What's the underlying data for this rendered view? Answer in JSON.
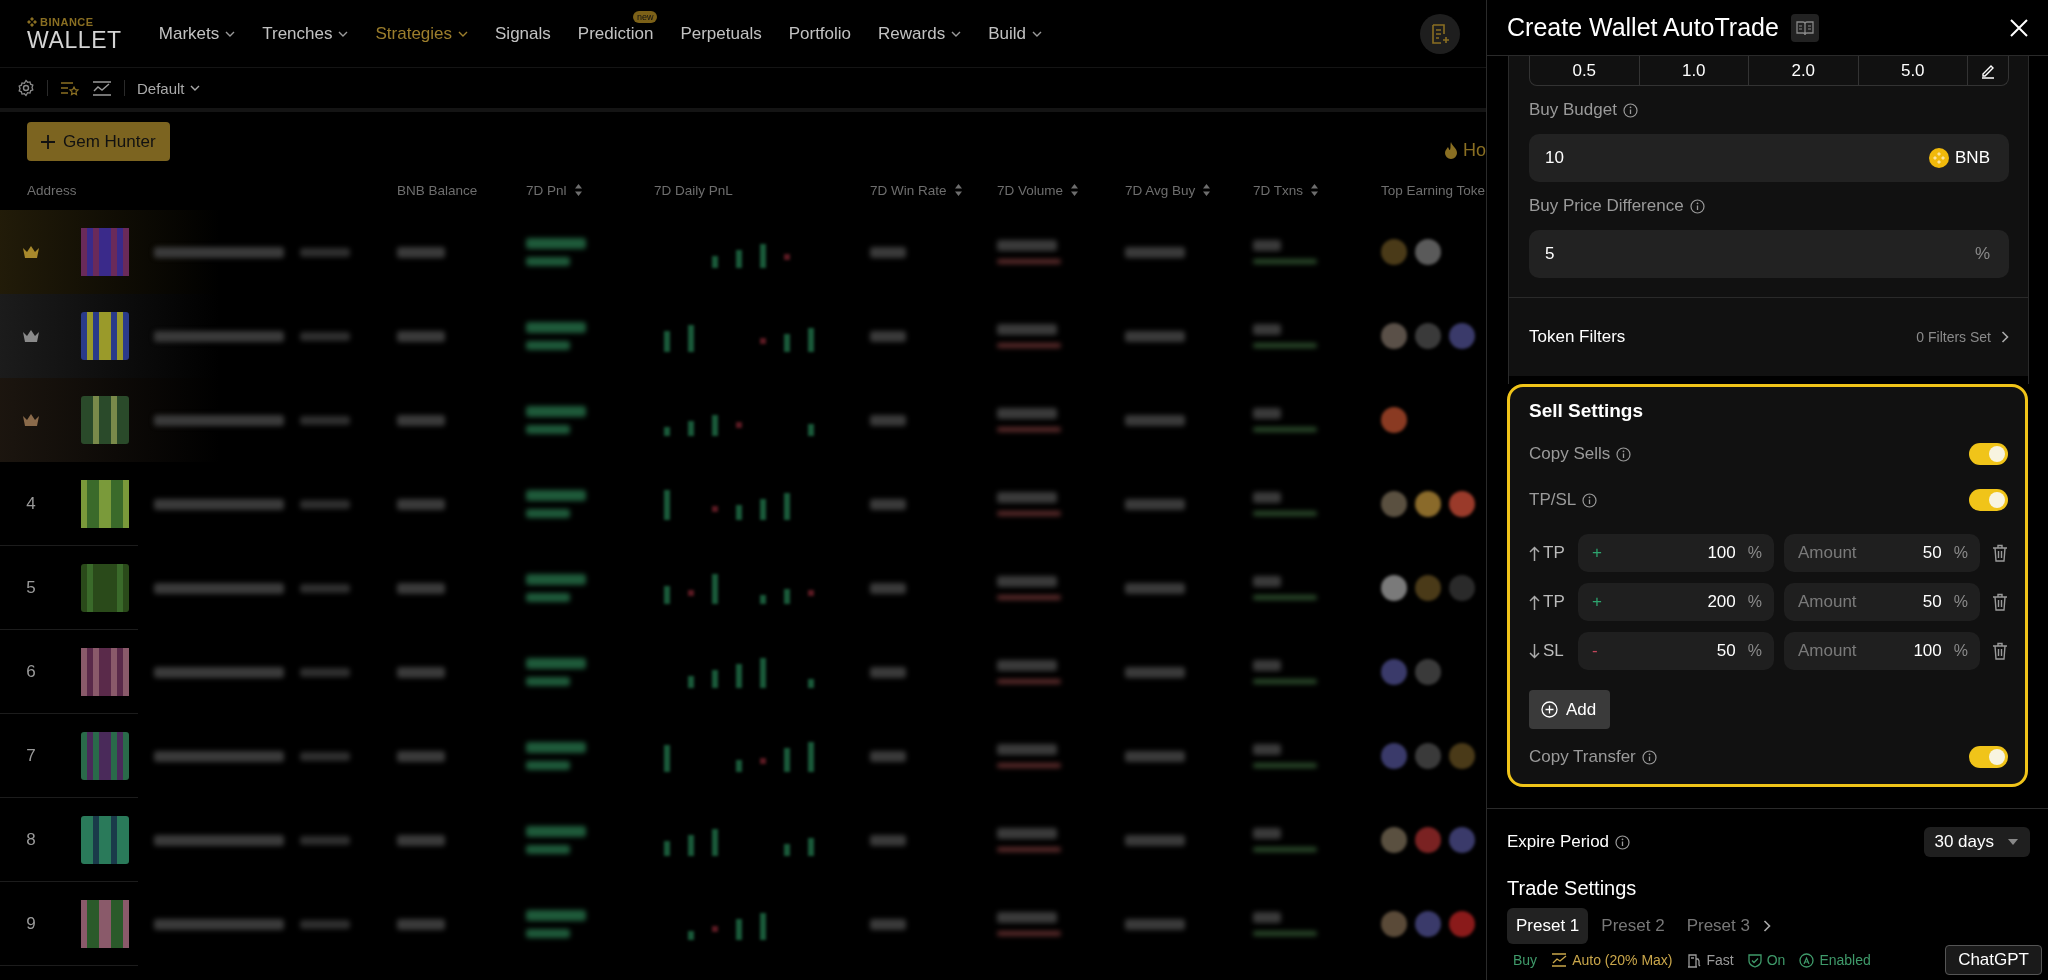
{
  "nav": {
    "logo_top": "BINANCE",
    "logo_bottom": "WALLET",
    "items": [
      {
        "label": "Markets",
        "dropdown": true,
        "selected": false
      },
      {
        "label": "Trenches",
        "dropdown": true,
        "selected": false
      },
      {
        "label": "Strategies",
        "dropdown": true,
        "selected": true
      },
      {
        "label": "Signals",
        "dropdown": false,
        "selected": false
      },
      {
        "label": "Prediction",
        "dropdown": false,
        "selected": false,
        "badge": "new"
      },
      {
        "label": "Perpetuals",
        "dropdown": false,
        "selected": false
      },
      {
        "label": "Portfolio",
        "dropdown": false,
        "selected": false
      },
      {
        "label": "Rewards",
        "dropdown": true,
        "selected": false
      },
      {
        "label": "Build",
        "dropdown": true,
        "selected": false
      }
    ]
  },
  "toolbar": {
    "view": "Default"
  },
  "actions": {
    "gem_hunter": "Gem Hunter",
    "hot_label": "Ho"
  },
  "table": {
    "columns": [
      {
        "label": "Address",
        "sortable": false
      },
      {
        "label": "BNB Balance",
        "sortable": false
      },
      {
        "label": "7D Pnl",
        "sortable": true
      },
      {
        "label": "7D Daily PnL",
        "sortable": false
      },
      {
        "label": "7D Win Rate",
        "sortable": true
      },
      {
        "label": "7D Volume",
        "sortable": true
      },
      {
        "label": "7D Avg Buy",
        "sortable": true
      },
      {
        "label": "7D Txns",
        "sortable": true
      },
      {
        "label": "Top Earning Toke",
        "sortable": false
      }
    ],
    "rows": [
      {
        "kind": "crown",
        "color": "#a8892c"
      },
      {
        "kind": "crown",
        "color": "#8a8a8a"
      },
      {
        "kind": "crown",
        "color": "#8a6a4a"
      },
      {
        "kind": "rank",
        "rank": "4"
      },
      {
        "kind": "rank",
        "rank": "5"
      },
      {
        "kind": "rank",
        "rank": "6"
      },
      {
        "kind": "rank",
        "rank": "7"
      },
      {
        "kind": "rank",
        "rank": "8"
      },
      {
        "kind": "rank",
        "rank": "9"
      }
    ]
  },
  "panel": {
    "title": "Create Wallet AutoTrade",
    "amount_presets": [
      "0.5",
      "1.0",
      "2.0",
      "5.0"
    ],
    "buy_budget": {
      "label": "Buy Budget",
      "value": "10",
      "unit": "BNB"
    },
    "buy_price_difference": {
      "label": "Buy Price Difference",
      "value": "5",
      "unit": "%"
    },
    "token_filters": {
      "label": "Token Filters",
      "value": "0 Filters Set"
    },
    "sell_settings": {
      "title": "Sell Settings",
      "toggles": [
        {
          "label": "Copy Sells",
          "on": true
        },
        {
          "label": "TP/SL",
          "on": true
        }
      ],
      "orders": [
        {
          "kind": "tp",
          "label": "TP",
          "sign": "+",
          "value": "100",
          "unit": "%",
          "amount_label": "Amount",
          "amount": "50",
          "amount_unit": "%"
        },
        {
          "kind": "tp",
          "label": "TP",
          "sign": "+",
          "value": "200",
          "unit": "%",
          "amount_label": "Amount",
          "amount": "50",
          "amount_unit": "%"
        },
        {
          "kind": "sl",
          "label": "SL",
          "sign": "-",
          "value": "50",
          "unit": "%",
          "amount_label": "Amount",
          "amount": "100",
          "amount_unit": "%"
        }
      ],
      "add": "Add",
      "copy_transfer": {
        "label": "Copy Transfer",
        "on": true
      }
    },
    "expire_period": {
      "label": "Expire Period",
      "value": "30 days"
    },
    "trade_settings": {
      "title": "Trade Settings",
      "presets": [
        {
          "label": "Preset 1",
          "selected": true
        },
        {
          "label": "Preset 2",
          "selected": false
        },
        {
          "label": "Preset 3",
          "selected": false
        }
      ],
      "tags": [
        {
          "kind": "text",
          "label": "Buy",
          "color": "#3f9a6a"
        },
        {
          "kind": "gas",
          "label": "Auto (20% Max)",
          "color": "#c9a64a"
        },
        {
          "kind": "speed",
          "label": "Fast",
          "color": "#9a9a9a"
        },
        {
          "kind": "shield",
          "label": "On",
          "color": "#3f9a6a"
        },
        {
          "kind": "auto",
          "label": "Enabled",
          "color": "#3f9a6a"
        }
      ]
    }
  },
  "chatgpt": "ChatGPT"
}
